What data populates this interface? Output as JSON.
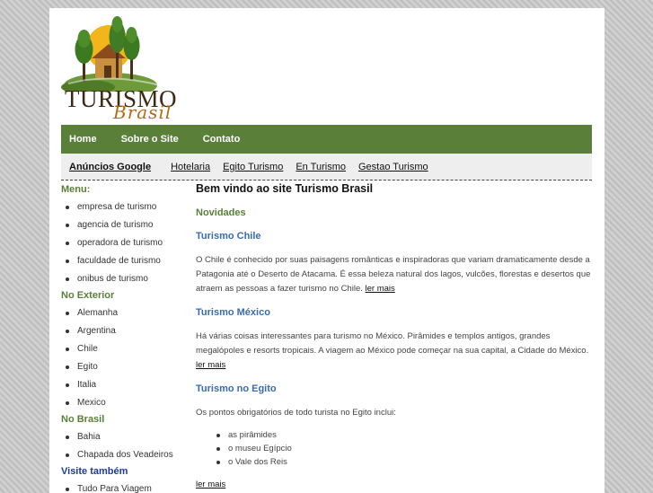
{
  "header": {
    "logo_word": "TURISMO",
    "logo_script": "Brasil",
    "logo_icon": "house-trees-sun-icon"
  },
  "nav": {
    "items": [
      "Home",
      "Sobre o Site",
      "Contato"
    ]
  },
  "ads": {
    "title": "Anúncios Google",
    "links": [
      "Hotelaria",
      "Egito Turismo",
      "En Turismo",
      "Gestao Turismo"
    ]
  },
  "sidebar": {
    "menu": {
      "title": "Menu:",
      "items": [
        "empresa de turismo",
        "agencia de turismo",
        "operadora de turismo",
        "faculdade de turismo",
        "onibus de turismo"
      ]
    },
    "exterior": {
      "title": "No Exterior",
      "items": [
        "Alemanha",
        "Argentina",
        "Chile",
        "Egito",
        "Italia",
        "Mexico"
      ]
    },
    "brasil": {
      "title": "No Brasil",
      "items": [
        "Bahia",
        "Chapada dos Veadeiros"
      ]
    },
    "visite": {
      "title": "Visite também",
      "items": [
        "Tudo Para Viagem"
      ]
    }
  },
  "content": {
    "welcome": "Bem vindo ao site Turismo Brasil",
    "section_title": "Novidades",
    "chile": {
      "title": "Turismo Chile",
      "text": "O Chile é conhecido por suas paisagens românticas e inspiradoras que variam dramaticamente desde a Patagonia até o Deserto de Atacama. É essa beleza natural dos lagos, vulcões, florestas e desertos que atraem as pessoas a fazer turismo no Chile.",
      "more": "ler mais"
    },
    "mexico": {
      "title": "Turismo México",
      "text": "Há várias coisas interessantes para turismo no México. Pirâmides e templos antigos, grandes megalópoles e resorts tropicais. A viagem ao México pode começar na sua capital, a Cidade do México.",
      "more": "ler mais"
    },
    "egito": {
      "title": "Turismo no Egito",
      "text": "Os pontos obrigatórios de todo turista no Egito inclui:",
      "items": [
        "as pirâmides",
        "o museu Egípcio",
        "o Vale dos Reis"
      ],
      "more": "ler mais"
    }
  },
  "colors": {
    "nav_green": "#597f38",
    "heading_green": "#597f38",
    "heading_blue": "#3a6bb0",
    "sidebar_blue": "#1d3c9c",
    "logo_brown": "#3c2a14",
    "logo_orange": "#b26b12"
  }
}
